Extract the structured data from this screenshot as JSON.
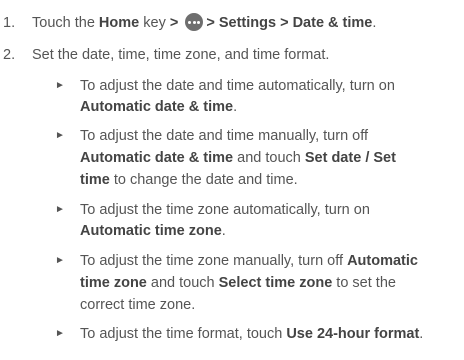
{
  "step1": {
    "number": "1.",
    "touch": "Touch the",
    "home": "Home",
    "key": "key",
    "gt1": ">",
    "gt2": "> Settings > Date & time",
    "period": ".",
    "icon": "apps-icon"
  },
  "step2": {
    "number": "2.",
    "text": "Set the date, time, time zone, and time format."
  },
  "bullet_marker": "►",
  "bullets": [
    {
      "l1a": "To adjust the date and time automatically, turn on",
      "l2b": "Automatic date & time",
      "l2c": "."
    },
    {
      "l1a": "To adjust the date and time manually, turn off",
      "l2b1": "Automatic date & time",
      "l2a": "and touch",
      "l2b2": "Set date",
      "l2sep": "/",
      "l2b3": "Set",
      "l3b": "time",
      "l3a": "to change the date and time."
    },
    {
      "l1a": "To adjust the time zone automatically, turn on",
      "l2b": "Automatic time zone",
      "l2c": "."
    },
    {
      "l1a": "To adjust the time zone manually, turn off",
      "l1b": "Automatic",
      "l2b1": "time zone",
      "l2a": "and touch",
      "l2b2": "Select time zone",
      "l2c": "to set the",
      "l3a": "correct time zone."
    },
    {
      "l1a": "To adjust the time format, touch",
      "l1b": "Use 24-hour format",
      "l1c": "."
    }
  ]
}
